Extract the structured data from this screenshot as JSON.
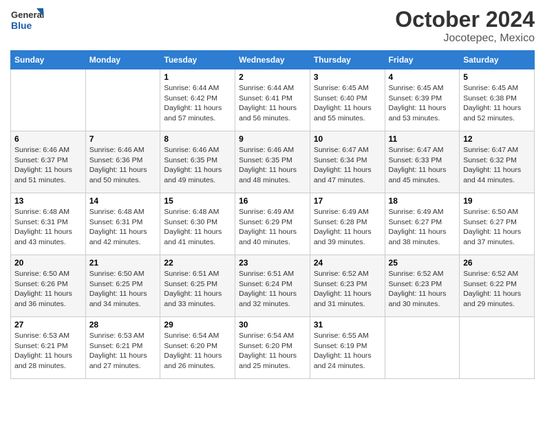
{
  "header": {
    "logo_general": "General",
    "logo_blue": "Blue",
    "month_title": "October 2024",
    "location": "Jocotepec, Mexico"
  },
  "weekdays": [
    "Sunday",
    "Monday",
    "Tuesday",
    "Wednesday",
    "Thursday",
    "Friday",
    "Saturday"
  ],
  "weeks": [
    [
      {
        "day": "",
        "info": ""
      },
      {
        "day": "",
        "info": ""
      },
      {
        "day": "1",
        "info": "Sunrise: 6:44 AM\nSunset: 6:42 PM\nDaylight: 11 hours and 57 minutes."
      },
      {
        "day": "2",
        "info": "Sunrise: 6:44 AM\nSunset: 6:41 PM\nDaylight: 11 hours and 56 minutes."
      },
      {
        "day": "3",
        "info": "Sunrise: 6:45 AM\nSunset: 6:40 PM\nDaylight: 11 hours and 55 minutes."
      },
      {
        "day": "4",
        "info": "Sunrise: 6:45 AM\nSunset: 6:39 PM\nDaylight: 11 hours and 53 minutes."
      },
      {
        "day": "5",
        "info": "Sunrise: 6:45 AM\nSunset: 6:38 PM\nDaylight: 11 hours and 52 minutes."
      }
    ],
    [
      {
        "day": "6",
        "info": "Sunrise: 6:46 AM\nSunset: 6:37 PM\nDaylight: 11 hours and 51 minutes."
      },
      {
        "day": "7",
        "info": "Sunrise: 6:46 AM\nSunset: 6:36 PM\nDaylight: 11 hours and 50 minutes."
      },
      {
        "day": "8",
        "info": "Sunrise: 6:46 AM\nSunset: 6:35 PM\nDaylight: 11 hours and 49 minutes."
      },
      {
        "day": "9",
        "info": "Sunrise: 6:46 AM\nSunset: 6:35 PM\nDaylight: 11 hours and 48 minutes."
      },
      {
        "day": "10",
        "info": "Sunrise: 6:47 AM\nSunset: 6:34 PM\nDaylight: 11 hours and 47 minutes."
      },
      {
        "day": "11",
        "info": "Sunrise: 6:47 AM\nSunset: 6:33 PM\nDaylight: 11 hours and 45 minutes."
      },
      {
        "day": "12",
        "info": "Sunrise: 6:47 AM\nSunset: 6:32 PM\nDaylight: 11 hours and 44 minutes."
      }
    ],
    [
      {
        "day": "13",
        "info": "Sunrise: 6:48 AM\nSunset: 6:31 PM\nDaylight: 11 hours and 43 minutes."
      },
      {
        "day": "14",
        "info": "Sunrise: 6:48 AM\nSunset: 6:31 PM\nDaylight: 11 hours and 42 minutes."
      },
      {
        "day": "15",
        "info": "Sunrise: 6:48 AM\nSunset: 6:30 PM\nDaylight: 11 hours and 41 minutes."
      },
      {
        "day": "16",
        "info": "Sunrise: 6:49 AM\nSunset: 6:29 PM\nDaylight: 11 hours and 40 minutes."
      },
      {
        "day": "17",
        "info": "Sunrise: 6:49 AM\nSunset: 6:28 PM\nDaylight: 11 hours and 39 minutes."
      },
      {
        "day": "18",
        "info": "Sunrise: 6:49 AM\nSunset: 6:27 PM\nDaylight: 11 hours and 38 minutes."
      },
      {
        "day": "19",
        "info": "Sunrise: 6:50 AM\nSunset: 6:27 PM\nDaylight: 11 hours and 37 minutes."
      }
    ],
    [
      {
        "day": "20",
        "info": "Sunrise: 6:50 AM\nSunset: 6:26 PM\nDaylight: 11 hours and 36 minutes."
      },
      {
        "day": "21",
        "info": "Sunrise: 6:50 AM\nSunset: 6:25 PM\nDaylight: 11 hours and 34 minutes."
      },
      {
        "day": "22",
        "info": "Sunrise: 6:51 AM\nSunset: 6:25 PM\nDaylight: 11 hours and 33 minutes."
      },
      {
        "day": "23",
        "info": "Sunrise: 6:51 AM\nSunset: 6:24 PM\nDaylight: 11 hours and 32 minutes."
      },
      {
        "day": "24",
        "info": "Sunrise: 6:52 AM\nSunset: 6:23 PM\nDaylight: 11 hours and 31 minutes."
      },
      {
        "day": "25",
        "info": "Sunrise: 6:52 AM\nSunset: 6:23 PM\nDaylight: 11 hours and 30 minutes."
      },
      {
        "day": "26",
        "info": "Sunrise: 6:52 AM\nSunset: 6:22 PM\nDaylight: 11 hours and 29 minutes."
      }
    ],
    [
      {
        "day": "27",
        "info": "Sunrise: 6:53 AM\nSunset: 6:21 PM\nDaylight: 11 hours and 28 minutes."
      },
      {
        "day": "28",
        "info": "Sunrise: 6:53 AM\nSunset: 6:21 PM\nDaylight: 11 hours and 27 minutes."
      },
      {
        "day": "29",
        "info": "Sunrise: 6:54 AM\nSunset: 6:20 PM\nDaylight: 11 hours and 26 minutes."
      },
      {
        "day": "30",
        "info": "Sunrise: 6:54 AM\nSunset: 6:20 PM\nDaylight: 11 hours and 25 minutes."
      },
      {
        "day": "31",
        "info": "Sunrise: 6:55 AM\nSunset: 6:19 PM\nDaylight: 11 hours and 24 minutes."
      },
      {
        "day": "",
        "info": ""
      },
      {
        "day": "",
        "info": ""
      }
    ]
  ]
}
